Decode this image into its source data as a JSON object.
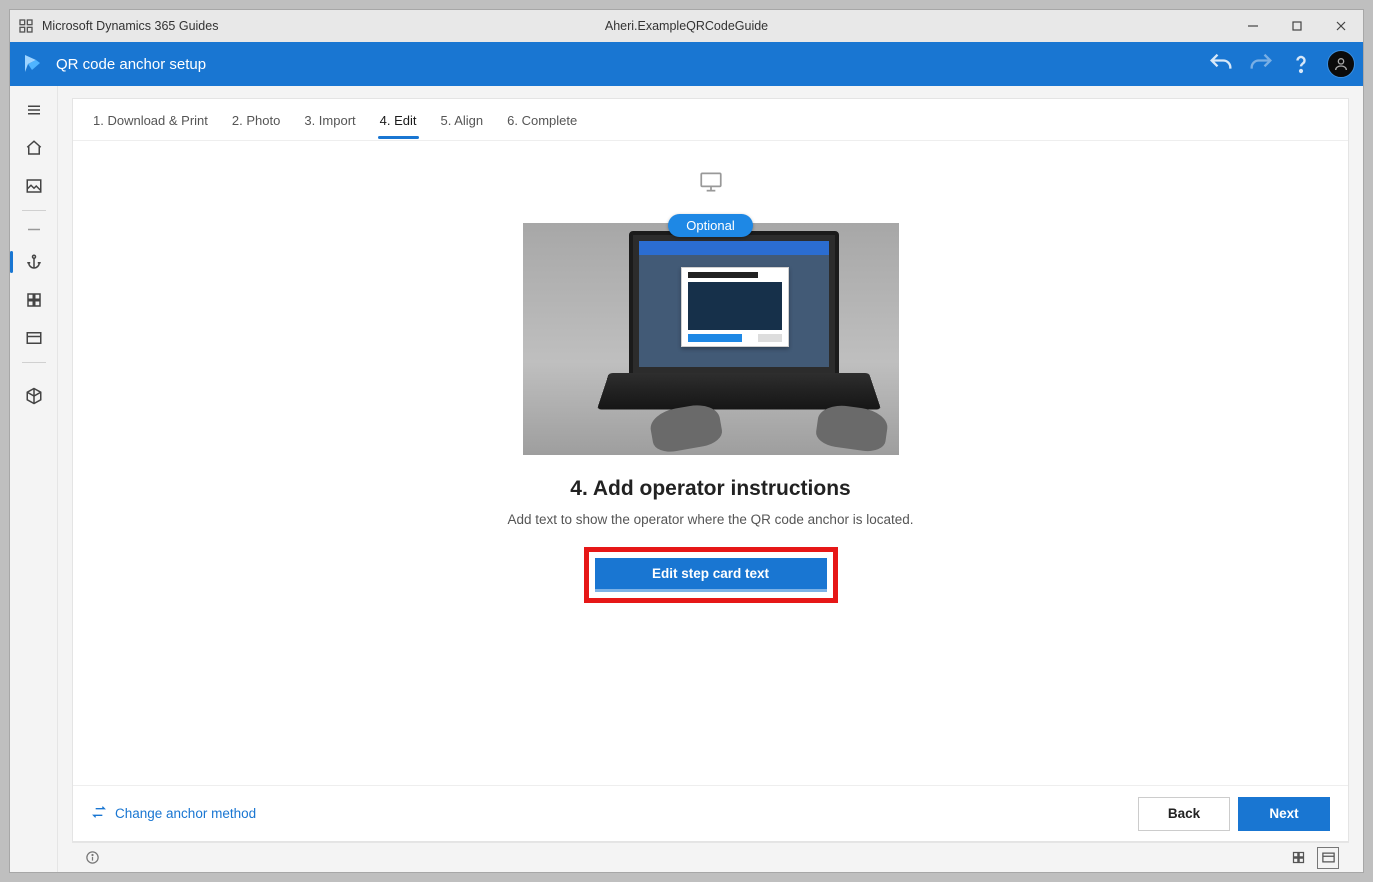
{
  "titlebar": {
    "app_name": "Microsoft Dynamics 365 Guides",
    "document_name": "Aheri.ExampleQRCodeGuide"
  },
  "bluebar": {
    "title": "QR code anchor setup"
  },
  "steps": [
    "1. Download & Print",
    "2. Photo",
    "3. Import",
    "4. Edit",
    "5. Align",
    "6. Complete"
  ],
  "active_step_index": 3,
  "content": {
    "optional_label": "Optional",
    "heading": "4. Add operator instructions",
    "description": "Add text to show the operator where the QR code anchor is located.",
    "primary_button": "Edit step card text"
  },
  "footer": {
    "change_link": "Change anchor method",
    "back_label": "Back",
    "next_label": "Next"
  },
  "siderail_active_index": 4
}
